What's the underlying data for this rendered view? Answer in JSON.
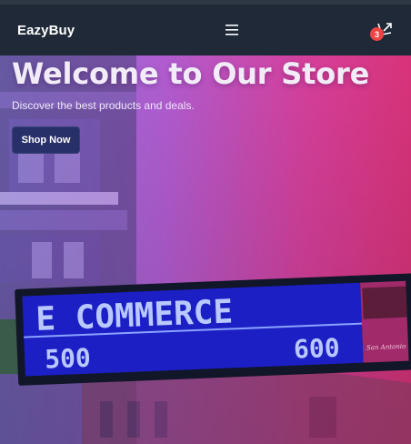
{
  "navbar": {
    "brand": "EazyBuy",
    "menu_icon": "hamburger-menu-icon",
    "cart_icon": "cart-icon",
    "cart_count": "3"
  },
  "hero": {
    "title": "Welcome to Our Store",
    "subtitle": "Discover the best products and deals.",
    "cta_label": "Shop Now"
  },
  "sign": {
    "main_text": "E COMMERCE",
    "left_number": "500",
    "right_number": "600",
    "corner_text": "San Antonio"
  },
  "colors": {
    "navbar_bg": "#1f2937",
    "gradient_left": "#9a6bd8",
    "gradient_right": "#e0307a",
    "badge": "#ef4444",
    "button": "#28306a",
    "sign_blue": "#1c1fc4"
  }
}
